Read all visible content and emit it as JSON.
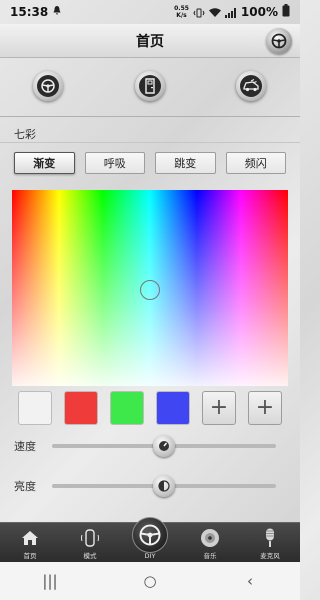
{
  "status_bar": {
    "time": "15:38",
    "notification_icon": "bell-icon",
    "net_speed_value": "0.55",
    "net_speed_unit": "K/s",
    "battery": "100%"
  },
  "header": {
    "title": "首页",
    "corner_icon": "steering-wheel-icon"
  },
  "devices": [
    {
      "icon": "steering-wheel-icon"
    },
    {
      "icon": "car-door-icon"
    },
    {
      "icon": "car-icon"
    }
  ],
  "section_label": "七彩",
  "modes": [
    "渐变",
    "呼吸",
    "跳变",
    "频闪"
  ],
  "active_mode": "渐变",
  "swatches": [
    {
      "color": "#f2f2f2"
    },
    {
      "color": "#f03b3b"
    },
    {
      "color": "#3fe84a"
    },
    {
      "color": "#3f46f2"
    }
  ],
  "add_swatch_symbol": "+",
  "sliders": {
    "speed": {
      "label": "速度",
      "value": 0.5
    },
    "brightness": {
      "label": "亮度",
      "value": 0.5
    }
  },
  "bottom_nav": [
    {
      "label": "首页",
      "icon": "home-icon"
    },
    {
      "label": "模式",
      "icon": "car-top-icon"
    },
    {
      "label": "DIY",
      "icon": "steering-wheel-icon"
    },
    {
      "label": "音乐",
      "icon": "disc-icon"
    },
    {
      "label": "麦克风",
      "icon": "microphone-icon"
    }
  ],
  "system_nav": {
    "recents": "|||",
    "home": "○",
    "back": "‹"
  }
}
